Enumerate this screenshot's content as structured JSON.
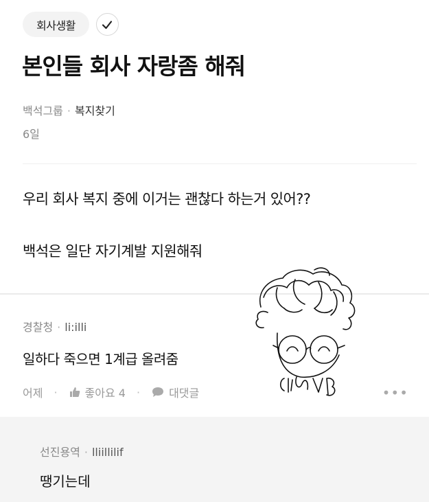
{
  "post": {
    "category_tag": "회사생활",
    "title": "본인들 회사 자랑좀 해줘",
    "author_company": "백석그룹",
    "board": "복지찾기",
    "date": "6일",
    "body_lines": [
      "우리 회사 복지 중에 이거는 괜찮다 하는거 있어??",
      "백석은 일단 자기계발 지원해줘"
    ]
  },
  "comment": {
    "author_company": "경찰청",
    "author_nick": "li:illi",
    "text": "일하다 죽으면 1계급 올려줌",
    "time": "어제",
    "like_label": "좋아요 4",
    "reply_label": "대댓글",
    "more_label": "•••"
  },
  "reply": {
    "author_company": "선진용역",
    "author_nick": "lliillilif",
    "text": "땡기는데"
  },
  "icons": {
    "verified": "check-icon",
    "like": "thumbs-up-icon",
    "reply": "speech-bubble-icon",
    "more": "more-dots-icon"
  }
}
